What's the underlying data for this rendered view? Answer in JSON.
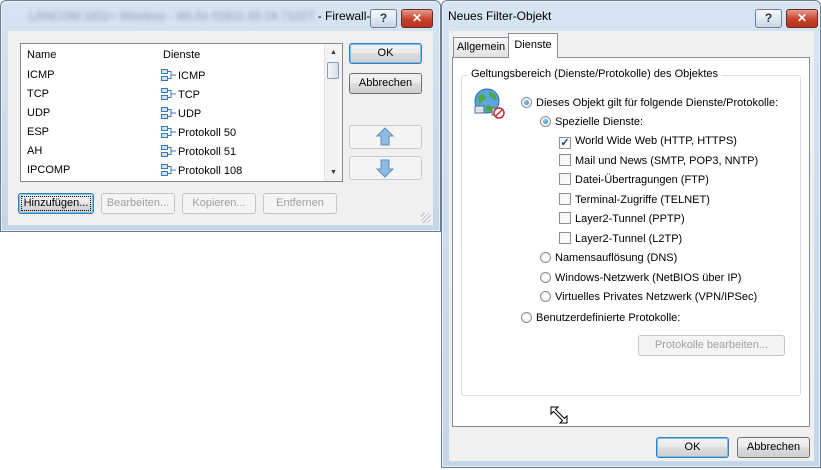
{
  "left_window": {
    "title_blurred": "LANCOM 1811+ Wireless - WLSs 01811 03 24 71227",
    "title_suffix": "- Firewall-Di...",
    "help_glyph": "?",
    "close_glyph": "✕",
    "list": {
      "columns": [
        "Name",
        "Dienste"
      ],
      "rows": [
        {
          "name": "ICMP",
          "service": "ICMP"
        },
        {
          "name": "TCP",
          "service": "TCP"
        },
        {
          "name": "UDP",
          "service": "UDP"
        },
        {
          "name": "ESP",
          "service": "Protokoll 50"
        },
        {
          "name": "AH",
          "service": "Protokoll 51"
        },
        {
          "name": "IPCOMP",
          "service": "Protokoll 108"
        }
      ]
    },
    "buttons": {
      "ok": "OK",
      "cancel": "Abbrechen",
      "add": "Hinzufügen...",
      "edit": "Bearbeiten...",
      "copy": "Kopieren...",
      "remove": "Entfernen"
    }
  },
  "right_window": {
    "title": "Neues Filter-Objekt",
    "help_glyph": "?",
    "close_glyph": "✕",
    "tabs": [
      {
        "label": "Allgemein",
        "active": false
      },
      {
        "label": "Dienste",
        "active": true
      }
    ],
    "group_title": "Geltungsbereich (Dienste/Protokolle) des Objektes",
    "radio_main": "Dieses Objekt gilt für folgende Dienste/Protokolle:",
    "radio_special": "Spezielle Dienste:",
    "checkboxes": [
      {
        "label": "World Wide Web (HTTP, HTTPS)",
        "checked": true
      },
      {
        "label": "Mail und News (SMTP, POP3, NNTP)",
        "checked": false
      },
      {
        "label": "Datei-Übertragungen (FTP)",
        "checked": false
      },
      {
        "label": "Terminal-Zugriffe (TELNET)",
        "checked": false
      },
      {
        "label": "Layer2-Tunnel (PPTP)",
        "checked": false
      },
      {
        "label": "Layer2-Tunnel (L2TP)",
        "checked": false
      }
    ],
    "radio_dns": "Namensauflösung (DNS)",
    "radio_netbios": "Windows-Netzwerk (NetBIOS über IP)",
    "radio_vpn": "Virtuelles Privates Netzwerk (VPN/IPSec)",
    "radio_custom": "Benutzerdefinierte Protokolle:",
    "edit_protocols_button": "Protokolle bearbeiten...",
    "ok": "OK",
    "cancel": "Abbrechen"
  },
  "colors": {
    "title_gradient_top": "#d6e4f3",
    "close_red": "#c7402b",
    "arrow_blue": "#6fa6d6",
    "dialog_bg": "#f0f0f0"
  }
}
